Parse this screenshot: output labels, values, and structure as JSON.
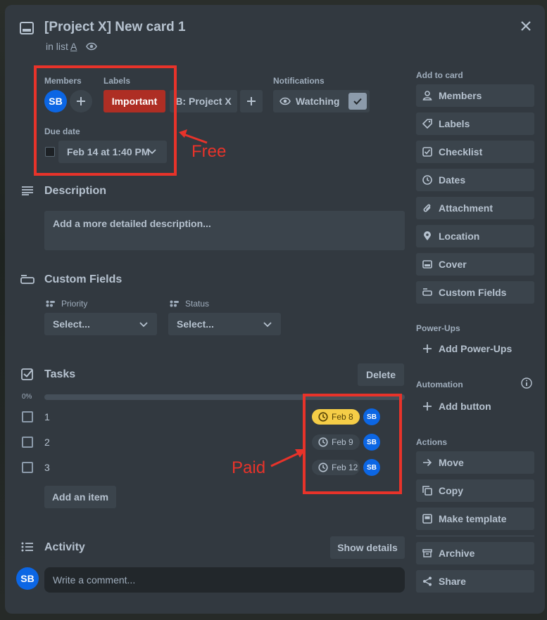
{
  "card": {
    "title": "[Project X] New card 1",
    "in_list_prefix": "in list",
    "list_name": "A"
  },
  "members": {
    "label": "Members",
    "avatar": "SB"
  },
  "labels": {
    "label": "Labels",
    "items": [
      "Important",
      "B: Project X"
    ]
  },
  "notifications": {
    "label": "Notifications",
    "watching": "Watching"
  },
  "due_date": {
    "label": "Due date",
    "value": "Feb 14 at 1:40 PM"
  },
  "description": {
    "title": "Description",
    "placeholder": "Add a more detailed description..."
  },
  "custom_fields": {
    "title": "Custom Fields",
    "fields": [
      {
        "label": "Priority",
        "value": "Select..."
      },
      {
        "label": "Status",
        "value": "Select..."
      }
    ]
  },
  "tasks": {
    "title": "Tasks",
    "delete_label": "Delete",
    "progress_label": "0%",
    "progress": 0,
    "items": [
      {
        "text": "1",
        "due": "Feb 8",
        "assignee": "SB",
        "highlight": true
      },
      {
        "text": "2",
        "due": "Feb 9",
        "assignee": "SB",
        "highlight": false
      },
      {
        "text": "3",
        "due": "Feb 12",
        "assignee": "SB",
        "highlight": false
      }
    ],
    "add_item": "Add an item"
  },
  "activity": {
    "title": "Activity",
    "show_details": "Show details",
    "avatar": "SB",
    "comment_placeholder": "Write a comment..."
  },
  "sidebar": {
    "add_to_card": "Add to card",
    "add_items": [
      "Members",
      "Labels",
      "Checklist",
      "Dates",
      "Attachment",
      "Location",
      "Cover",
      "Custom Fields"
    ],
    "power_ups_label": "Power-Ups",
    "add_power_ups": "Add Power-Ups",
    "automation_label": "Automation",
    "add_button": "Add button",
    "actions_label": "Actions",
    "actions": [
      "Move",
      "Copy",
      "Make template",
      "Archive",
      "Share"
    ]
  },
  "annotations": {
    "free": "Free",
    "paid": "Paid"
  },
  "colors": {
    "annotation": "#e8332a",
    "important_label": "#ae2e24",
    "avatar": "#0c66e4",
    "due_highlight": "#f5cd47"
  }
}
